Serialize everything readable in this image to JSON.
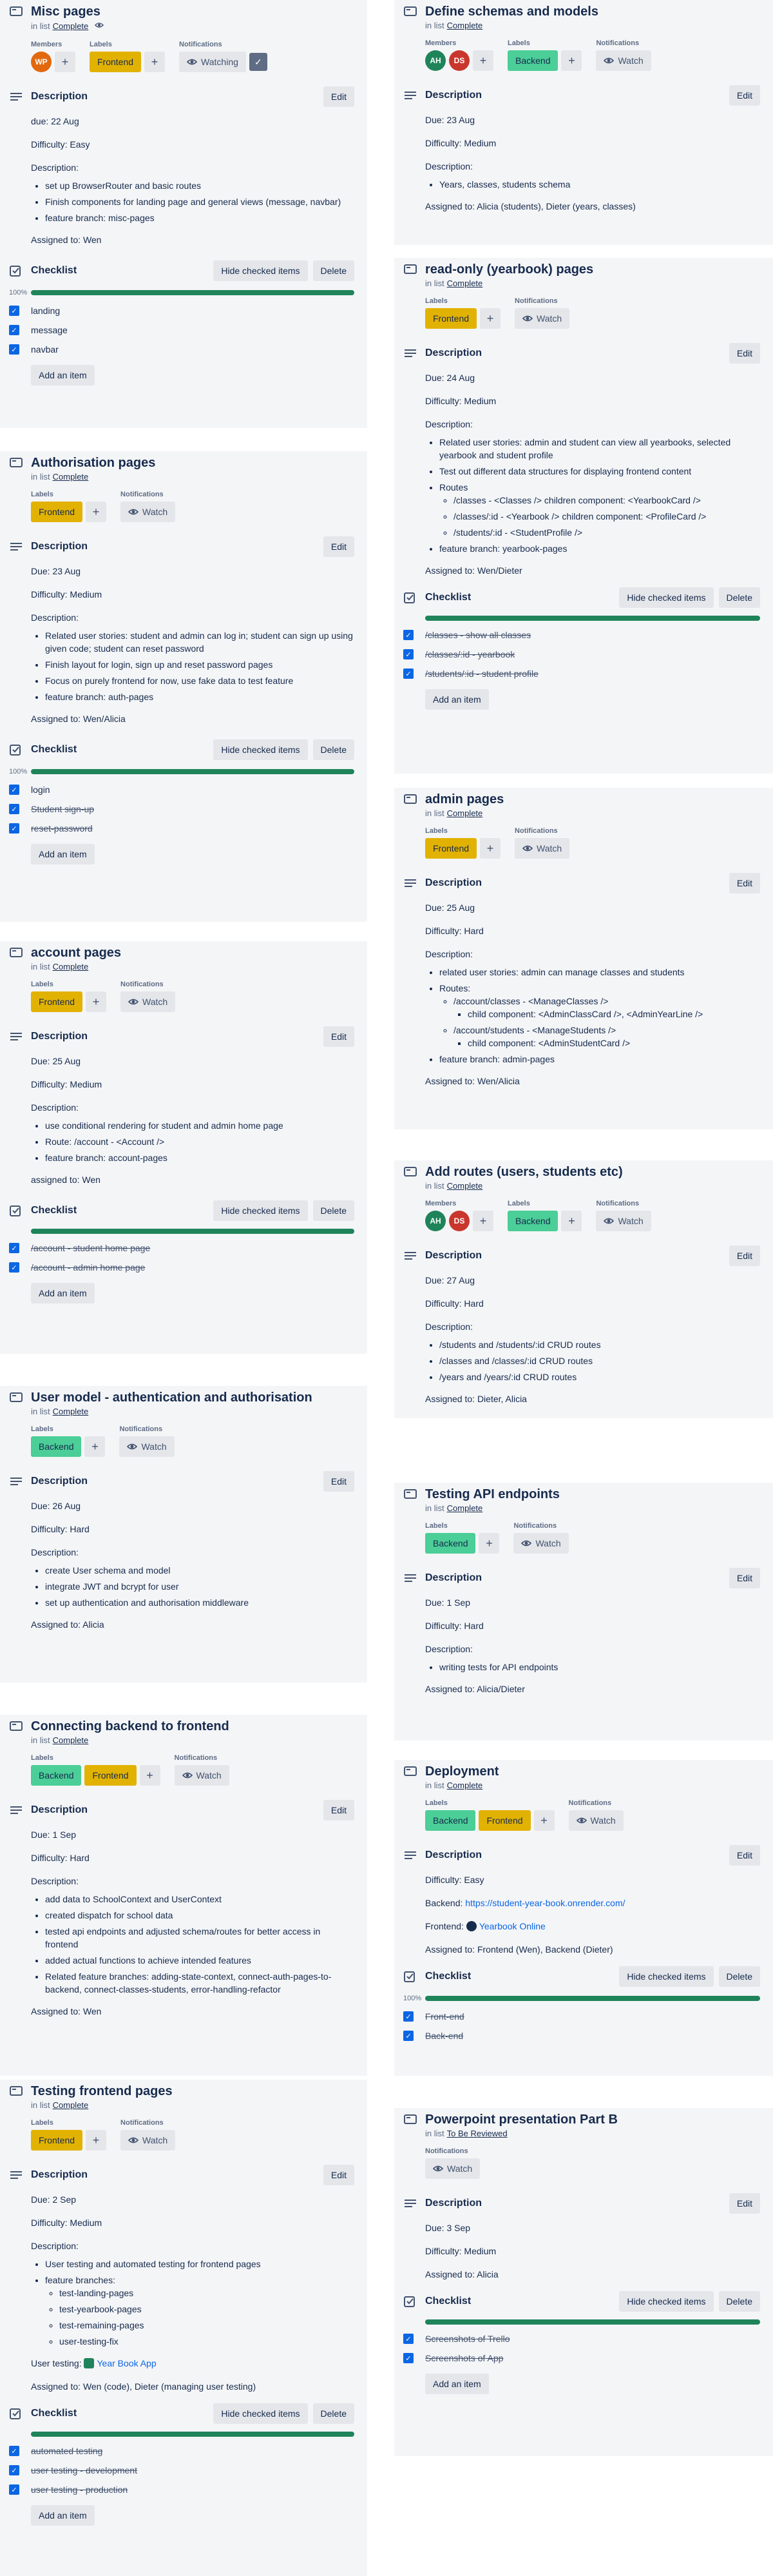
{
  "common": {
    "in_list": "in list",
    "members": "Members",
    "labels": "Labels",
    "notifications": "Notifications",
    "description": "Description",
    "checklist": "Checklist",
    "edit": "Edit",
    "hide_checked": "Hide checked items",
    "delete": "Delete",
    "add_item": "Add an item",
    "watch": "Watch",
    "watching": "Watching",
    "complete": "Complete",
    "frontend": "Frontend",
    "backend": "Backend",
    "pct100": "100%"
  },
  "colors": {
    "frontend": "#e2b203",
    "backend": "#4bce97",
    "progress": "#1f845a",
    "checkbox": "#0c66e4"
  },
  "misc": {
    "title": "Misc pages",
    "member": "WP",
    "d1": "due: 22 Aug",
    "d2": "Difficulty: Easy",
    "d3": "Description:",
    "items": [
      "set up BrowserRouter and basic routes",
      "Finish components for landing page and general views (message, navbar)",
      "feature branch: misc-pages"
    ],
    "assigned": "Assigned to: Wen",
    "checklist": [
      "landing",
      "message",
      "navbar"
    ]
  },
  "auth": {
    "title": "Authorisation pages",
    "d1": "Due: 23 Aug",
    "d2": "Difficulty: Medium",
    "d3": "Description:",
    "items": [
      "Related user stories: student and admin can log in; student can sign up using given code; student can reset password",
      "Finish layout for login, sign up and reset password pages",
      "Focus on purely frontend for now, use fake data to test feature",
      "feature branch: auth-pages"
    ],
    "assigned": "Assigned to: Wen/Alicia",
    "checklist": [
      "login",
      "Student sign-up",
      "reset-password"
    ]
  },
  "account": {
    "title": "account pages",
    "d1": "Due: 25 Aug",
    "d2": "Difficulty: Medium",
    "d3": "Description:",
    "items": [
      "use conditional rendering for student and admin home page",
      "Route: /account - <Account />",
      "feature branch: account-pages"
    ],
    "assigned": "assigned to: Wen",
    "checklist": [
      "/account - student home page",
      "/account - admin home page"
    ]
  },
  "usermodel": {
    "title": "User model - authentication and authorisation",
    "d1": "Due: 26 Aug",
    "d2": "Difficulty: Hard",
    "d3": "Description:",
    "items": [
      "create User schema and model",
      "integrate JWT and bcrypt for user",
      "set up authentication and authorisation middleware"
    ],
    "assigned": "Assigned to: Alicia"
  },
  "connecting": {
    "title": "Connecting backend to frontend",
    "d1": "Due: 1 Sep",
    "d2": "Difficulty: Hard",
    "d3": "Description:",
    "items": [
      "add data to SchoolContext and UserContext",
      "created dispatch for school data",
      "tested api endpoints and adjusted schema/routes for better access in frontend",
      "added actual functions to achieve intended features",
      "Related feature branches: adding-state-context, connect-auth-pages-to-backend, connect-classes-students, error-handling-refactor"
    ],
    "assigned": "Assigned to: Wen"
  },
  "testingfe": {
    "title": "Testing frontend pages",
    "d1": "Due: 2 Sep",
    "d2": "Difficulty: Medium",
    "d3": "Description:",
    "items": [
      "User testing and automated testing for frontend pages",
      "feature branches:"
    ],
    "sub": [
      "test-landing-pages",
      "test-yearbook-pages",
      "test-remaining-pages",
      "user-testing-fix"
    ],
    "usertesting": "User testing:",
    "usertesting_link": "Year Book App",
    "assigned": "Assigned to: Wen (code), Dieter (managing user testing)",
    "checklist": [
      "automated testing",
      "user testing - development",
      "user testing - production"
    ]
  },
  "schemas": {
    "title": "Define schemas and models",
    "m1": "AH",
    "m2": "DS",
    "d1": "Due: 23 Aug",
    "d2": "Difficulty: Medium",
    "d3": "Description:",
    "items": [
      "Years, classes, students schema"
    ],
    "assigned": "Assigned to: Alicia (students), Dieter (years, classes)"
  },
  "yearbook": {
    "title": "read-only (yearbook) pages",
    "d1": "Due: 24 Aug",
    "d2": "Difficulty: Medium",
    "d3": "Description:",
    "items": [
      "Related user stories: admin and student can view all yearbooks, selected yearbook and student profile",
      "Test out different data structures for displaying frontend content",
      "Routes"
    ],
    "sub": [
      "/classes - <Classes /> children component: <YearbookCard />",
      "/classes/:id - <Yearbook /> children component: <ProfileCard />",
      "/students/:id - <StudentProfile />"
    ],
    "item_last": "feature branch: yearbook-pages",
    "assigned": "Assigned to: Wen/Dieter",
    "checklist": [
      "/classes - show all classes",
      "/classes/:id - yearbook",
      "/students/:id - student profile"
    ]
  },
  "admin": {
    "title": "admin pages",
    "d1": "Due: 25 Aug",
    "d2": "Difficulty: Hard",
    "d3": "Description:",
    "i1": "related user stories: admin can manage classes and students",
    "i2": "Routes:",
    "s1": "/account/classes - <ManageClasses />",
    "s1c": "child component: <AdminClassCard />, <AdminYearLine />",
    "s2": "/account/students - <ManageStudents />",
    "s2c": "child component: <AdminStudentCard />",
    "i3": "feature branch: admin-pages",
    "assigned": "Assigned to: Wen/Alicia"
  },
  "routes": {
    "title": "Add routes (users, students etc)",
    "m1": "AH",
    "m2": "DS",
    "d1": "Due: 27 Aug",
    "d2": "Difficulty: Hard",
    "d3": "Description:",
    "items": [
      "/students and /students/:id CRUD routes",
      "/classes and /classes/:id CRUD routes",
      "/years and /years/:id CRUD routes"
    ],
    "assigned": "Assigned to: Dieter, Alicia"
  },
  "testapi": {
    "title": "Testing API endpoints",
    "d1": "Due: 1 Sep",
    "d2": "Difficulty: Hard",
    "d3": "Description:",
    "items": [
      "writing tests for API endpoints"
    ],
    "assigned": "Assigned to: Alicia/Dieter"
  },
  "deploy": {
    "title": "Deployment",
    "d1": "Difficulty: Easy",
    "backend_lbl": "Backend:",
    "backend_url": "https://student-year-book.onrender.com/",
    "frontend_lbl": "Frontend:",
    "frontend_link": "Yearbook Online",
    "assigned": "Assigned to: Frontend (Wen), Backend (Dieter)",
    "checklist": [
      "Front-end",
      "Back-end"
    ]
  },
  "ppt": {
    "title": "Powerpoint presentation Part B",
    "list": "To Be Reviewed",
    "d1": "Due: 3 Sep",
    "d2": "Difficulty: Medium",
    "assigned": "Assigned to: Alicia",
    "checklist": [
      "Screenshots of Trello",
      "Screenshots of App"
    ]
  }
}
